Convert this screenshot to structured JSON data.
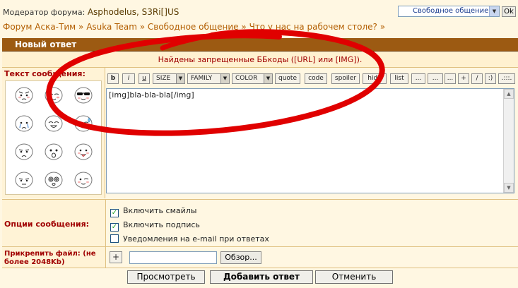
{
  "header": {
    "moderators_label": "Модератор форума:",
    "moderators_names": "Asphodelus, S3Ri[]US",
    "forum_select_value": "Свободное общение",
    "ok_label": "Ok"
  },
  "breadcrumb": {
    "items": [
      "Форум Аска-Тим",
      "Asuka Team",
      "Свободное общение",
      "Что у нас на рабочем столе?"
    ],
    "separator": "»",
    "trailing": "»"
  },
  "form": {
    "title": "Новый ответ",
    "error": "Найдены запрещенные ББкоды ([URL] или [IMG]).",
    "message_label": "Текст сообщения:",
    "message_value": "[img]bla-bla-bla[/img]",
    "toolbar": {
      "bold": "b",
      "italic": "i",
      "underline": "u",
      "size": "SIZE",
      "family": "FAMILY",
      "color": "COLOR",
      "quote": "quote",
      "code": "code",
      "spoiler": "spoiler",
      "hide": "hide",
      "list": "list",
      "e1": "...",
      "e2": "...",
      "e3": "...",
      "plus": "+",
      "slash": "/",
      "smile": ":)",
      "more": ".:::."
    },
    "options_label": "Опции сообщения:",
    "options": [
      {
        "label": "Включить смайлы",
        "checked": true
      },
      {
        "label": "Включить подпись",
        "checked": true
      },
      {
        "label": "Уведомления на e-mail при ответах",
        "checked": false
      }
    ],
    "attach_label": "Прикрепить файл:",
    "attach_limit": "(не более 2048Kb)",
    "attach_plus": "+",
    "browse_label": "Обзор...",
    "preview_label": "Просмотреть",
    "submit_label": "Добавить ответ",
    "cancel_label": "Отменить"
  },
  "smileys": [
    "angry-smiley",
    "blush-smiley",
    "cool-smiley",
    "cry-smiley",
    "happy-smiley",
    "sweat-smiley",
    "sad-smiley",
    "shocked-smiley",
    "tongue-smiley",
    "pout-smiley",
    "dizzy-smiley",
    "wink-smiley"
  ],
  "colors": {
    "title_bar": "#9c5a12",
    "error": "#a00000",
    "breadcrumb": "#b25d00",
    "annotation": "#e00000"
  }
}
